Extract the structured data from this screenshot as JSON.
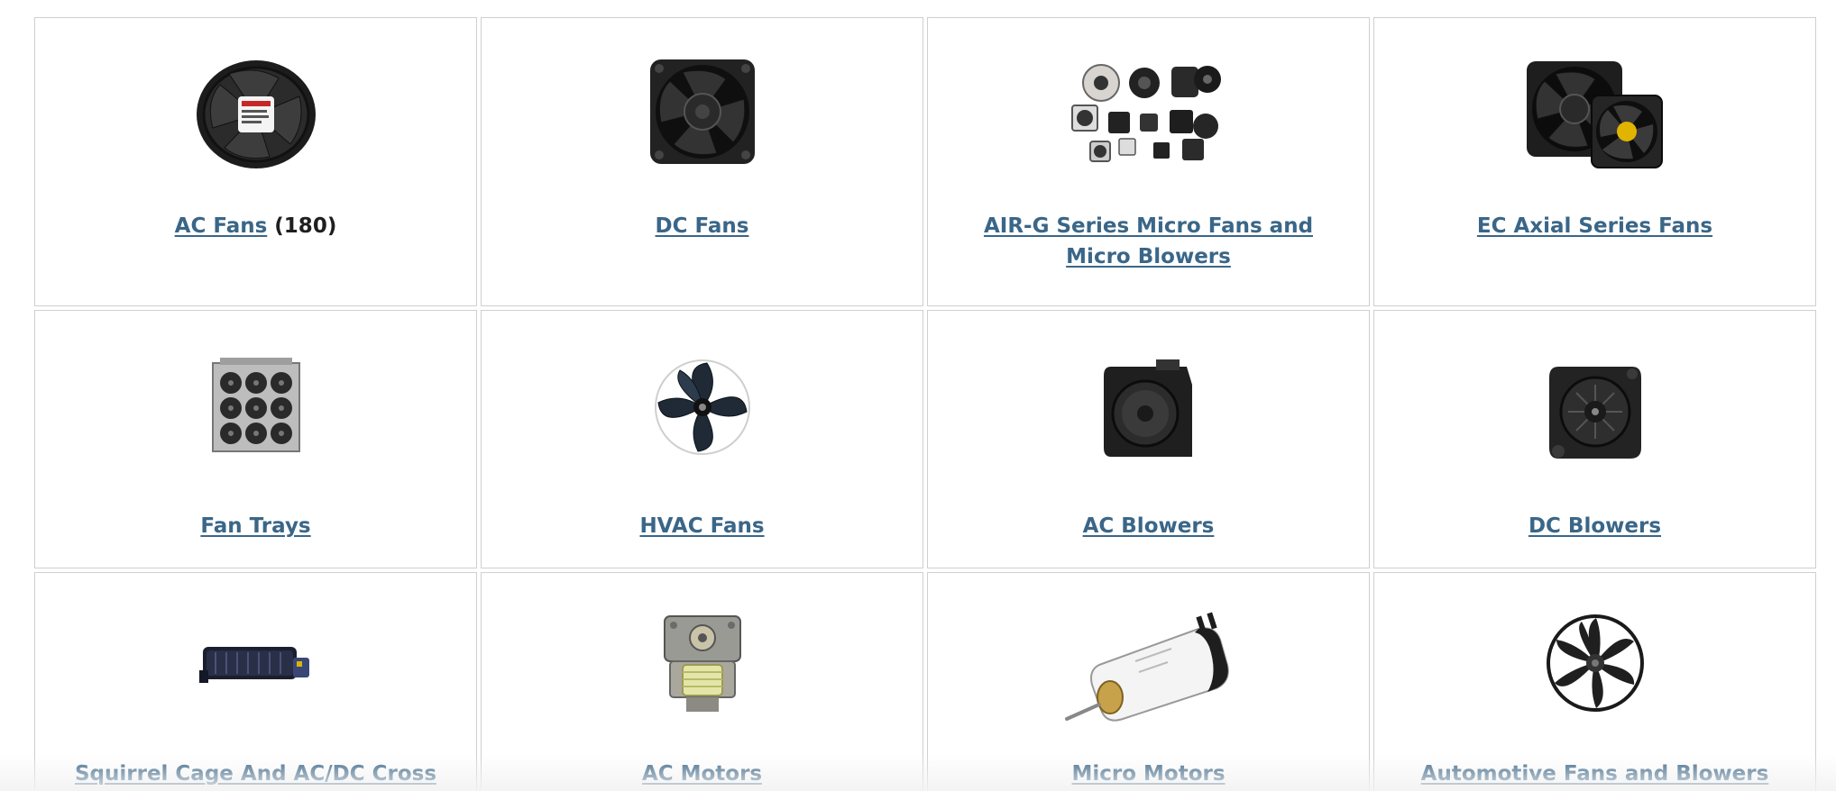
{
  "categories": [
    {
      "name": "AC Fans",
      "count": "(180)",
      "icon": "ac-fan-icon"
    },
    {
      "name": "DC Fans",
      "count": "",
      "icon": "dc-fan-icon"
    },
    {
      "name": "AIR-G Series Micro Fans and Micro Blowers",
      "count": "",
      "icon": "micro-fans-group-icon"
    },
    {
      "name": "EC Axial Series Fans",
      "count": "",
      "icon": "ec-axial-fans-icon"
    },
    {
      "name": "Fan Trays",
      "count": "",
      "icon": "fan-tray-icon"
    },
    {
      "name": "HVAC Fans",
      "count": "",
      "icon": "hvac-fan-icon"
    },
    {
      "name": "AC Blowers",
      "count": "",
      "icon": "ac-blower-icon"
    },
    {
      "name": "DC Blowers",
      "count": "",
      "icon": "dc-blower-icon"
    },
    {
      "name": "Squirrel Cage And AC/DC Cross",
      "count": "",
      "icon": "squirrel-cage-blower-icon"
    },
    {
      "name": "AC Motors",
      "count": "",
      "icon": "ac-motor-icon"
    },
    {
      "name": "Micro Motors",
      "count": "",
      "icon": "micro-motor-icon"
    },
    {
      "name": "Automotive Fans and Blowers",
      "count": "",
      "icon": "automotive-fan-icon"
    }
  ],
  "colors": {
    "link": "#3a6688",
    "border": "#cfcfcf",
    "count": "#1f1f1f"
  }
}
